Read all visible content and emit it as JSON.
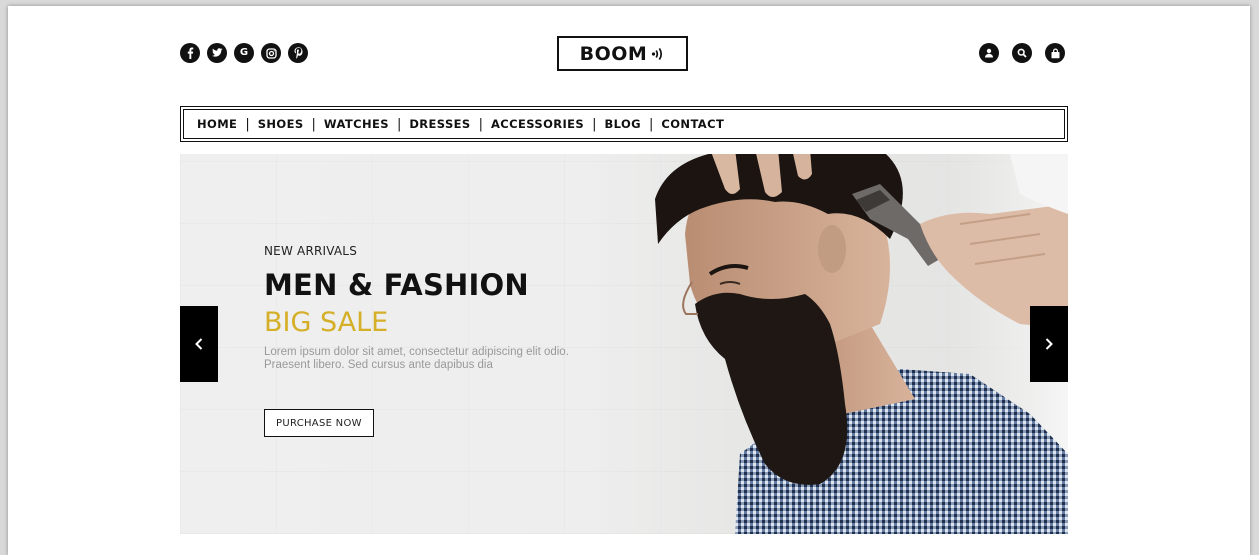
{
  "header": {
    "logo_text": "BOOM",
    "social_icons": [
      "facebook-icon",
      "twitter-icon",
      "google-icon",
      "instagram-icon",
      "pinterest-icon"
    ],
    "social_google_glyph": "G",
    "action_icons": [
      "user-icon",
      "search-icon",
      "shopping-bag-icon"
    ]
  },
  "nav": {
    "items": [
      "HOME",
      "SHOES",
      "WATCHES",
      "DRESSES",
      "ACCESSORIES",
      "BLOG",
      "CONTACT"
    ],
    "separator": "|"
  },
  "hero": {
    "kicker": "NEW ARRIVALS",
    "headline": "MEN & FASHION",
    "subhead": "BIG SALE",
    "blurb": "Lorem ipsum dolor sit amet, consectetur adipiscing elit odio. Praesent libero. Sed cursus ante dapibus dia",
    "cta_label": "PURCHASE NOW",
    "prev_icon": "chevron-left-icon",
    "next_icon": "chevron-right-icon"
  },
  "colors": {
    "accent": "#d4af27",
    "dark": "#111111",
    "muted_text": "#999999",
    "background": "#ffffff"
  }
}
